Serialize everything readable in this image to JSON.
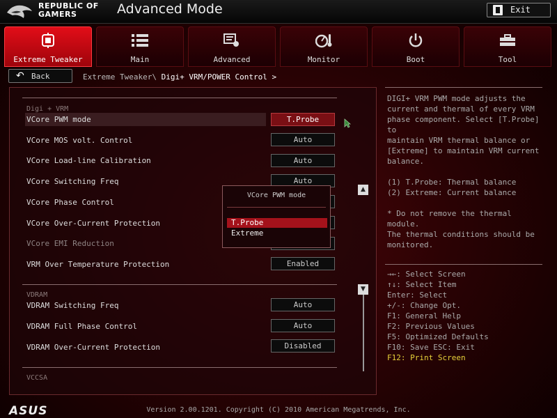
{
  "header": {
    "brand_line1": "REPUBLIC OF",
    "brand_line2": "GAMERS",
    "title": "Advanced Mode",
    "exit_label": "Exit"
  },
  "tabs": [
    {
      "label": "Extreme Tweaker",
      "icon": "chip-icon",
      "active": true
    },
    {
      "label": "Main",
      "icon": "list-icon",
      "active": false
    },
    {
      "label": "Advanced",
      "icon": "advanced-icon",
      "active": false
    },
    {
      "label": "Monitor",
      "icon": "monitor-gauge-icon",
      "active": false
    },
    {
      "label": "Boot",
      "icon": "power-icon",
      "active": false
    },
    {
      "label": "Tool",
      "icon": "toolbox-icon",
      "active": false
    }
  ],
  "nav": {
    "back_label": "Back",
    "breadcrumb_parent": "Extreme Tweaker\\",
    "breadcrumb_current": "Digi+ VRM/POWER Control >"
  },
  "main": {
    "section_digi": "Digi + VRM",
    "section_vdram": "VDRAM",
    "section_vccsa": "VCCSA",
    "rows": [
      {
        "label": "VCore PWM mode",
        "value": "T.Probe"
      },
      {
        "label": "VCore MOS volt. Control",
        "value": "Auto"
      },
      {
        "label": "VCore Load-line Calibration",
        "value": "Auto"
      },
      {
        "label": "VCore Switching Freq",
        "value": "Auto"
      },
      {
        "label": "VCore Phase Control",
        "value": ""
      },
      {
        "label": "VCore Over-Current Protection",
        "value": ""
      },
      {
        "label": "VCore EMI Reduction",
        "value": ""
      },
      {
        "label": "VRM Over Temperature Protection",
        "value": "Enabled"
      },
      {
        "label": "VDRAM Switching Freq",
        "value": "Auto"
      },
      {
        "label": "VDRAM Full Phase Control",
        "value": "Auto"
      },
      {
        "label": "VDRAM Over-Current Protection",
        "value": "Disabled"
      }
    ]
  },
  "popup": {
    "title": "VCore PWM mode",
    "options": [
      "T.Probe",
      "Extreme"
    ],
    "selected": "T.Probe"
  },
  "help": {
    "description": "DIGI+ VRM PWM mode adjusts the\ncurrent and thermal of every VRM\nphase component. Select [T.Probe] to\nmaintain VRM thermal balance or\n[Extreme] to maintain VRM current\nbalance.\n\n(1) T.Probe: Thermal balance\n(2) Extreme: Current balance\n\n* Do not remove the thermal module.\nThe thermal conditions should be\nmonitored.",
    "keys": [
      "→←: Select Screen",
      "↑↓: Select Item",
      "Enter: Select",
      "+/-: Change Opt.",
      "F1: General Help",
      "F2: Previous Values",
      "F5: Optimized Defaults",
      "F10: Save  ESC: Exit",
      "F12: Print Screen"
    ]
  },
  "footer": {
    "brand": "ASUS",
    "version": "Version 2.00.1201. Copyright (C) 2010 American Megatrends, Inc."
  },
  "colors": {
    "accent": "#e20d18",
    "hotkey": "#e8d23a",
    "background": "#2a0204"
  }
}
